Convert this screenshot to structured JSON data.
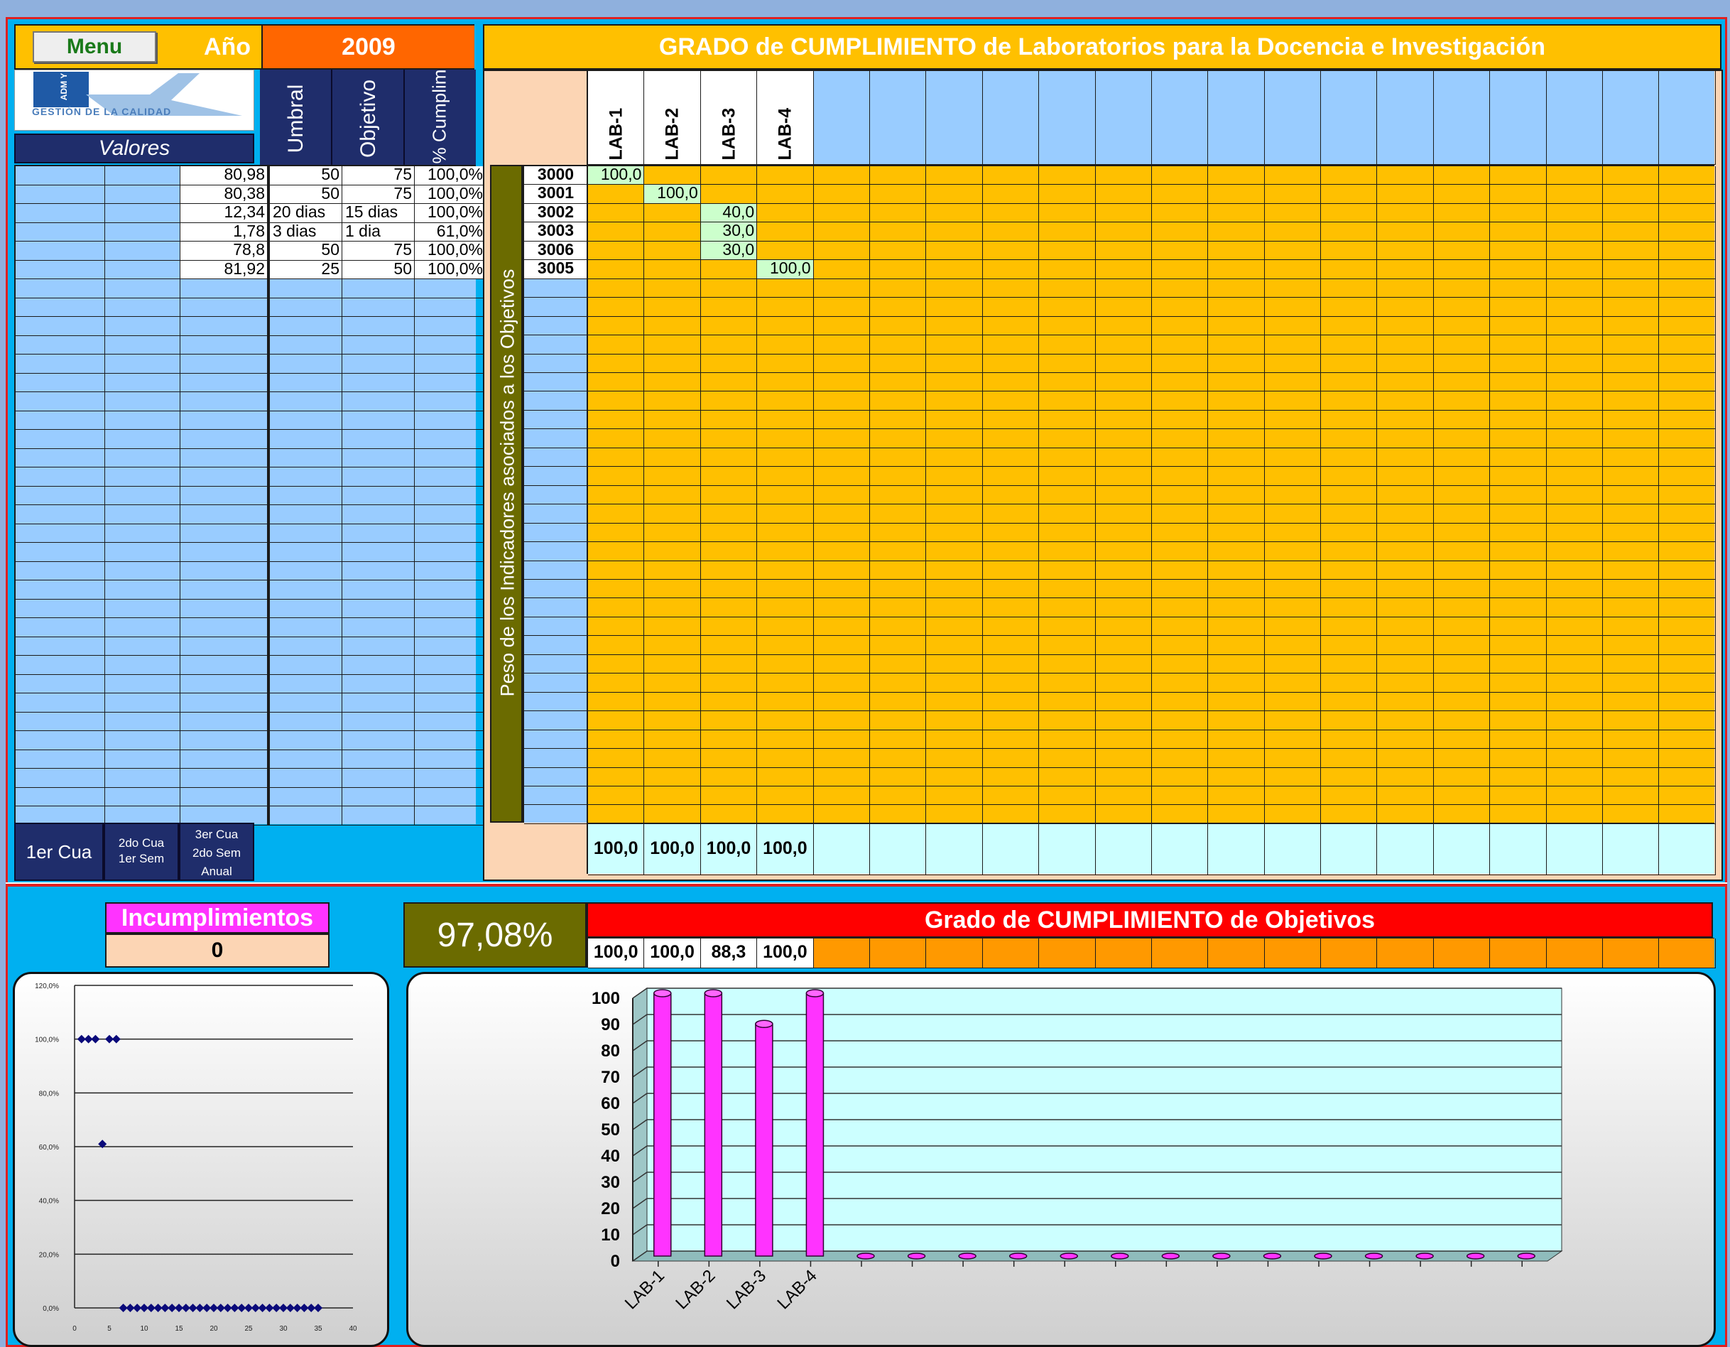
{
  "header": {
    "menu_label": "Menu",
    "year_label": "Año",
    "year_value": "2009",
    "title": "GRADO de CUMPLIMIENTO de Laboratorios para la Docencia e Investigación"
  },
  "logo": {
    "caption": "GESTIÓN DE LA CALIDAD",
    "side_text": "ADM Y"
  },
  "left_panel": {
    "values_label": "Valores",
    "col_umbral": "Umbral",
    "col_objetivo": "Objetivo",
    "col_cumplimiento": "% Cumplimie",
    "rows": [
      {
        "valor": "80,98",
        "umbral": "50",
        "objetivo": "75",
        "pct": "100,0%"
      },
      {
        "valor": "80,38",
        "umbral": "50",
        "objetivo": "75",
        "pct": "100,0%"
      },
      {
        "valor": "12,34",
        "umbral": "20 dias",
        "objetivo": "15 dias",
        "pct": "100,0%"
      },
      {
        "valor": "1,78",
        "umbral": "3 dias",
        "objetivo": "1 dia",
        "pct": "61,0%"
      },
      {
        "valor": "78,8",
        "umbral": "50",
        "objetivo": "75",
        "pct": "100,0%"
      },
      {
        "valor": "81,92",
        "umbral": "25",
        "objetivo": "50",
        "pct": "100,0%"
      }
    ],
    "period_buttons": {
      "b1": "1er Cua",
      "b2a": "2do Cua",
      "b2b": "1er Sem",
      "b3a": "3er Cua",
      "b3b": "2do Sem",
      "b3c": "Anual"
    }
  },
  "matrix": {
    "side_label": "Peso de los Indicadores asociados a los Objetivos",
    "labs": [
      "LAB-1",
      "LAB-2",
      "LAB-3",
      "LAB-4"
    ],
    "indicators": [
      {
        "code": "3000",
        "lab": 0,
        "value": "100,0"
      },
      {
        "code": "3001",
        "lab": 1,
        "value": "100,0"
      },
      {
        "code": "3002",
        "lab": 2,
        "value": "40,0"
      },
      {
        "code": "3003",
        "lab": 2,
        "value": "30,0"
      },
      {
        "code": "3006",
        "lab": 2,
        "value": "30,0"
      },
      {
        "code": "3005",
        "lab": 3,
        "value": "100,0"
      }
    ],
    "totals": [
      "100,0",
      "100,0",
      "100,0",
      "100,0"
    ]
  },
  "summary": {
    "incumplimientos_label": "Incumplimientos",
    "incumplimientos_value": "0",
    "overall_pct": "97,08%",
    "objectives_title": "Grado de CUMPLIMIENTO de Objetivos",
    "objective_values": [
      "100,0",
      "100,0",
      "88,3",
      "100,0"
    ]
  },
  "colors": {
    "orange_grid": "#ffc000",
    "blue_grid": "#99ccff",
    "title_bar_red": "#ff0000",
    "title_bar_yellow": "#ffc000",
    "magenta": "#ff33ff",
    "olive": "#6b6b00",
    "navy": "#1f2d6b"
  },
  "chart_data": [
    {
      "type": "scatter",
      "title": "",
      "ylim": [
        0,
        120
      ],
      "xlim": [
        0,
        40
      ],
      "y_ticks": [
        "0,0%",
        "20,0%",
        "40,0%",
        "60,0%",
        "80,0%",
        "100,0%",
        "120,0%"
      ],
      "x_ticks": [
        "0",
        "5",
        "10",
        "15",
        "20",
        "25",
        "30",
        "35",
        "40"
      ],
      "grid": true,
      "series": [
        {
          "x": [
            1,
            2,
            3,
            4,
            5,
            6,
            7,
            8,
            9,
            10,
            11,
            12,
            13,
            14,
            15,
            16,
            17,
            18,
            19,
            20,
            21,
            22,
            23,
            24,
            25,
            26,
            27,
            28,
            29,
            30,
            31,
            32,
            33,
            34,
            35
          ],
          "y": [
            100,
            100,
            100,
            61,
            100,
            100,
            0,
            0,
            0,
            0,
            0,
            0,
            0,
            0,
            0,
            0,
            0,
            0,
            0,
            0,
            0,
            0,
            0,
            0,
            0,
            0,
            0,
            0,
            0,
            0,
            0,
            0,
            0,
            0,
            0
          ]
        }
      ]
    },
    {
      "type": "bar",
      "title": "",
      "categories": [
        "LAB-1",
        "LAB-2",
        "LAB-3",
        "LAB-4",
        "",
        "",
        "",
        "",
        "",
        "",
        "",
        "",
        "",
        "",
        "",
        "",
        "",
        ""
      ],
      "values": [
        100,
        100,
        88.3,
        100,
        0,
        0,
        0,
        0,
        0,
        0,
        0,
        0,
        0,
        0,
        0,
        0,
        0,
        0
      ],
      "ylim": [
        0,
        100
      ],
      "y_ticks": [
        "0",
        "10",
        "20",
        "30",
        "40",
        "50",
        "60",
        "70",
        "80",
        "90",
        "100"
      ],
      "grid": true
    }
  ]
}
